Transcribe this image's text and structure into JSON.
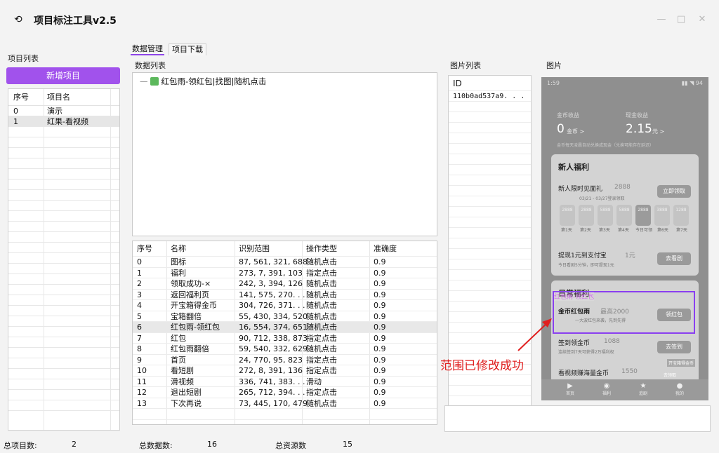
{
  "app": {
    "title": "项目标注工具v2.5",
    "icon": "app-icon"
  },
  "window": {
    "minimize": "—",
    "maximize": "□",
    "close": "✕"
  },
  "left": {
    "label": "项目列表",
    "add_button": "新增项目",
    "headers": [
      "序号",
      "项目名"
    ],
    "rows": [
      {
        "idx": "0",
        "name": "演示"
      },
      {
        "idx": "1",
        "name": "红果-看视频"
      }
    ]
  },
  "tabs": [
    "数据管理",
    "项目下载"
  ],
  "data_panel": {
    "label": "数据列表",
    "tree_item": "红包雨-领红包|找图|随机点击",
    "headers": [
      "序号",
      "名称",
      "识别范围",
      "操作类型",
      "准确度"
    ],
    "rows": [
      {
        "idx": "0",
        "name": "图标",
        "range": "87, 561, 321, 688",
        "op": "随机点击",
        "acc": "0.9"
      },
      {
        "idx": "1",
        "name": "福利",
        "range": "273, 7, 391, 103",
        "op": "指定点击",
        "acc": "0.9"
      },
      {
        "idx": "2",
        "name": "领取成功-×",
        "range": "242, 3, 394, 126",
        "op": "随机点击",
        "acc": "0.9"
      },
      {
        "idx": "3",
        "name": "返回福利页",
        "range": "141, 575, 270. . .",
        "op": "随机点击",
        "acc": "0.9"
      },
      {
        "idx": "4",
        "name": "开宝箱得金币",
        "range": "304, 726, 371. . .",
        "op": "随机点击",
        "acc": "0.9"
      },
      {
        "idx": "5",
        "name": "宝箱翻倍",
        "range": "55, 430, 334, 520",
        "op": "随机点击",
        "acc": "0.9"
      },
      {
        "idx": "6",
        "name": "红包雨-领红包",
        "range": "16, 554, 374, 651",
        "op": "随机点击",
        "acc": "0.9"
      },
      {
        "idx": "7",
        "name": "红包",
        "range": "90, 712, 338, 873",
        "op": "指定点击",
        "acc": "0.9"
      },
      {
        "idx": "8",
        "name": "红包雨翻倍",
        "range": "59, 540, 332, 629",
        "op": "随机点击",
        "acc": "0.9"
      },
      {
        "idx": "9",
        "name": "首页",
        "range": "24, 770, 95, 823",
        "op": "指定点击",
        "acc": "0.9"
      },
      {
        "idx": "10",
        "name": "看短剧",
        "range": "272, 8, 391, 136",
        "op": "指定点击",
        "acc": "0.9"
      },
      {
        "idx": "11",
        "name": "滑视频",
        "range": "336, 741, 383. . .",
        "op": "滑动",
        "acc": "0.9"
      },
      {
        "idx": "12",
        "name": "退出短剧",
        "range": "265, 712, 394. . .",
        "op": "指定点击",
        "acc": "0.9"
      },
      {
        "idx": "13",
        "name": "下次再说",
        "range": "73, 445, 170, 479",
        "op": "随机点击",
        "acc": "0.9"
      }
    ],
    "selected_row": 6
  },
  "image_list": {
    "label": "图片列表",
    "header": "ID",
    "rows": [
      "110b0ad537a9. . ."
    ]
  },
  "image_panel": {
    "label": "图片",
    "phone": {
      "time": "1:59",
      "status_right": "▮▮ ◥ 94",
      "coin_label": "金币收益",
      "cash_label": "现金收益",
      "coin_value": "0",
      "coin_unit": "金币 >",
      "cash_value": "2.15",
      "cash_unit": "元 >",
      "note": "金币每天凌晨自动兑换成现金（兑换可能存在延迟）",
      "newbie_title": "新人福利",
      "gift_title": "新人限时见面礼",
      "gift_amount": "2888",
      "gift_sub": "03/21 - 03/27登录领取",
      "gift_button": "立即领取",
      "days": [
        "2888",
        "2888",
        "5888",
        "5888",
        "2888",
        "3888",
        "1288"
      ],
      "day_labels": [
        "第1天",
        "第2天",
        "第3天",
        "第4天",
        "今日可领",
        "第6天",
        "第7天"
      ],
      "alipay_title": "提现1元到支付宝",
      "alipay_amount": "1元",
      "alipay_sub": "今日看剧5分钟，即可提现1元",
      "alipay_button": "去看剧",
      "daily_title": "日常福利",
      "hl_tag": "红包雨-领红包",
      "rain_title": "金币红包雨",
      "rain_amount": "最高2000",
      "rain_sub": "一大波红包来袭，先到先得",
      "rain_button": "领红包",
      "sign_title": "签到领金币",
      "sign_amount": "1088",
      "sign_sub": "连续签到7天可获得2万福利权",
      "sign_button": "去签到",
      "video_title": "看视频赚海量金币",
      "video_amount": "1550",
      "video_button": "去领取",
      "chest_label": "开宝箱得金币",
      "nav": [
        "首页",
        "福利",
        "追剧",
        "我的"
      ]
    }
  },
  "callout": "范围已修改成功",
  "status": {
    "total_projects_label": "总项目数:",
    "total_projects": "2",
    "total_data_label": "总数据数:",
    "total_data": "16",
    "total_resources_label": "总资源数",
    "total_resources": "15"
  },
  "colors": {
    "accent": "#a152ec",
    "highlight": "#8a3ff0",
    "callout": "#e02020"
  }
}
